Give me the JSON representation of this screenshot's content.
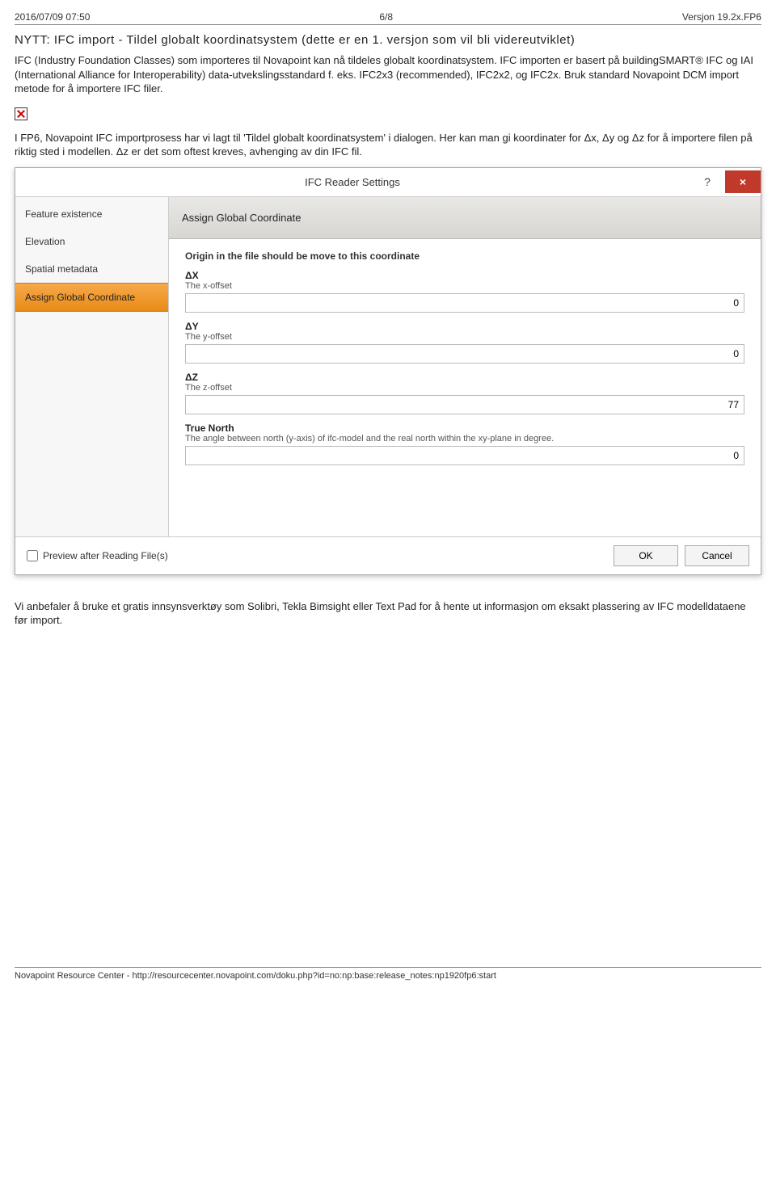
{
  "header": {
    "left": "2016/07/09 07:50",
    "center": "6/8",
    "right": "Versjon 19.2x.FP6"
  },
  "heading": "NYTT: IFC import - Tildel globalt koordinatsystem (dette er en 1. versjon som vil bli videreutviklet)",
  "para1": "IFC (Industry Foundation Classes) som importeres til Novapoint kan nå tildeles globalt koordinatsystem. IFC importen er basert på buildingSMART® IFC og IAI (International Alliance for Interoperability) data-utvekslingsstandard f. eks. IFC2x3 (recommended), IFC2x2, og IFC2x. Bruk standard Novapoint DCM import metode for å importere IFC filer.",
  "para2": "I FP6, Novapoint IFC importprosess har vi lagt til 'Tildel globalt koordinatsystem' i dialogen. Her kan man gi koordinater for Δx, Δy og Δz for å importere filen på riktig sted i modellen. Δz er det som oftest kreves, avhenging av din IFC fil.",
  "dialog": {
    "title": "IFC Reader Settings",
    "help_glyph": "?",
    "close_glyph": "×",
    "sidebar": {
      "items": [
        {
          "label": "Feature existence"
        },
        {
          "label": "Elevation"
        },
        {
          "label": "Spatial metadata"
        },
        {
          "label": "Assign Global Coordinate"
        }
      ]
    },
    "banner": "Assign Global Coordinate",
    "intro": "Origin in the file should be move to this coordinate",
    "fields": {
      "dx": {
        "label": "ΔX",
        "hint": "The x-offset",
        "value": "0"
      },
      "dy": {
        "label": "ΔY",
        "hint": "The y-offset",
        "value": "0"
      },
      "dz": {
        "label": "ΔZ",
        "hint": "The z-offset",
        "value": "77"
      },
      "tn": {
        "label": "True North",
        "hint": "The angle between north (y-axis) of ifc-model and the real north within the xy-plane in degree.",
        "value": "0"
      }
    },
    "preview_label": "Preview after Reading File(s)",
    "ok": "OK",
    "cancel": "Cancel"
  },
  "para3": "Vi anbefaler å bruke et gratis innsynsverktøy som Solibri, Tekla Bimsight eller Text Pad for å hente ut informasjon om eksakt plassering av IFC modelldataene før import.",
  "footer": "Novapoint Resource Center - http://resourcecenter.novapoint.com/doku.php?id=no:np:base:release_notes:np1920fp6:start"
}
